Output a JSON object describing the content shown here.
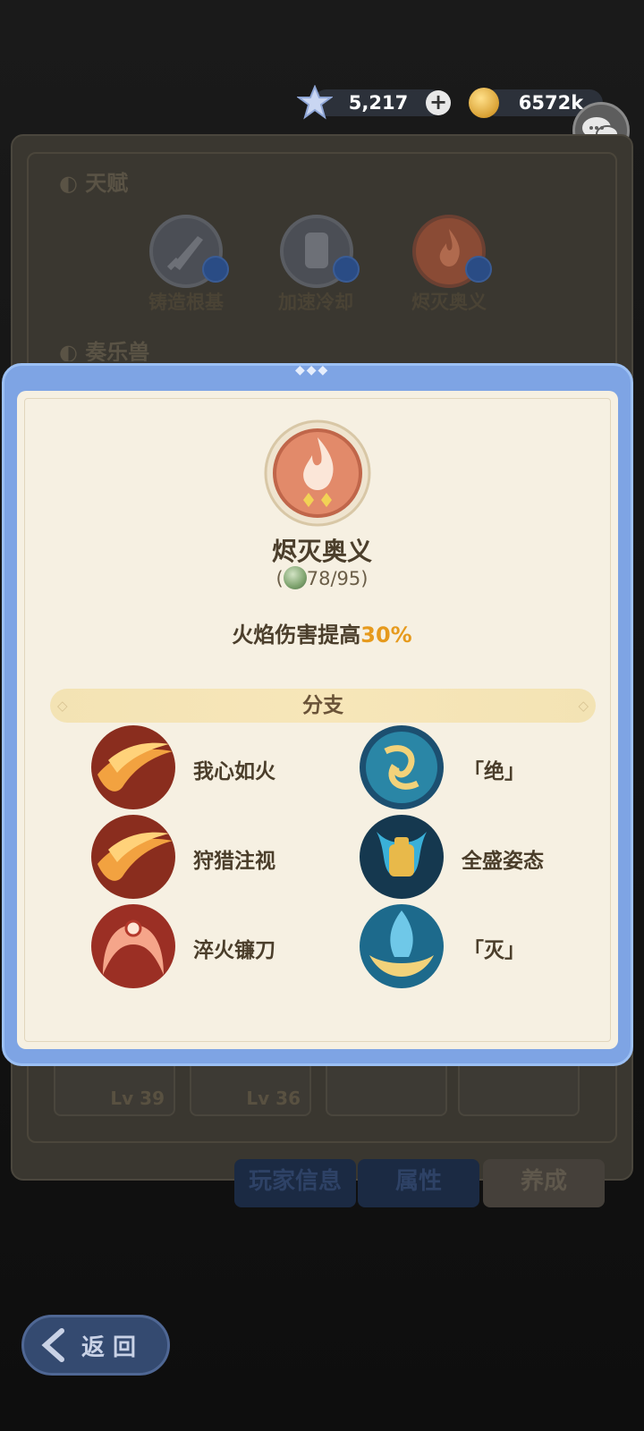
{
  "currency": {
    "gems": "5,217",
    "plus_label": "+",
    "coins": "6572k"
  },
  "background": {
    "section_talent": "天赋",
    "section_music": "奏乐兽",
    "talents": [
      {
        "label": "铸造根基",
        "icon": "sword-icon"
      },
      {
        "label": "加速冷却",
        "icon": "gauntlet-icon"
      },
      {
        "label": "烬灭奥义",
        "icon": "flame-icon"
      }
    ],
    "cards": [
      {
        "level": "39"
      },
      {
        "level": "36"
      }
    ],
    "level_prefix": "Lv",
    "tabs": [
      "玩家信息",
      "属性",
      "养成"
    ],
    "back_label": "返 回"
  },
  "modal": {
    "title": "烬灭奥义",
    "progress_open": "(",
    "progress": "78/95",
    "progress_close": ")",
    "description_prefix": "火焰伤害提高",
    "description_value": "30%",
    "branch_header": "分支",
    "branches_left": [
      {
        "label": "我心如火",
        "icon": "fire-slash-icon"
      },
      {
        "label": "狩猎注视",
        "icon": "fire-slash-icon"
      },
      {
        "label": "淬火镰刀",
        "icon": "fire-scythe-icon"
      }
    ],
    "branches_right": [
      {
        "label": "「绝」",
        "icon": "water-swirl-icon"
      },
      {
        "label": "全盛姿态",
        "icon": "golden-armor-icon"
      },
      {
        "label": "「灭」",
        "icon": "golden-crest-icon"
      }
    ]
  },
  "colors": {
    "accent": "#e69a1d",
    "modal_frame": "#7ea4e4",
    "paper": "#f6f0e2"
  }
}
